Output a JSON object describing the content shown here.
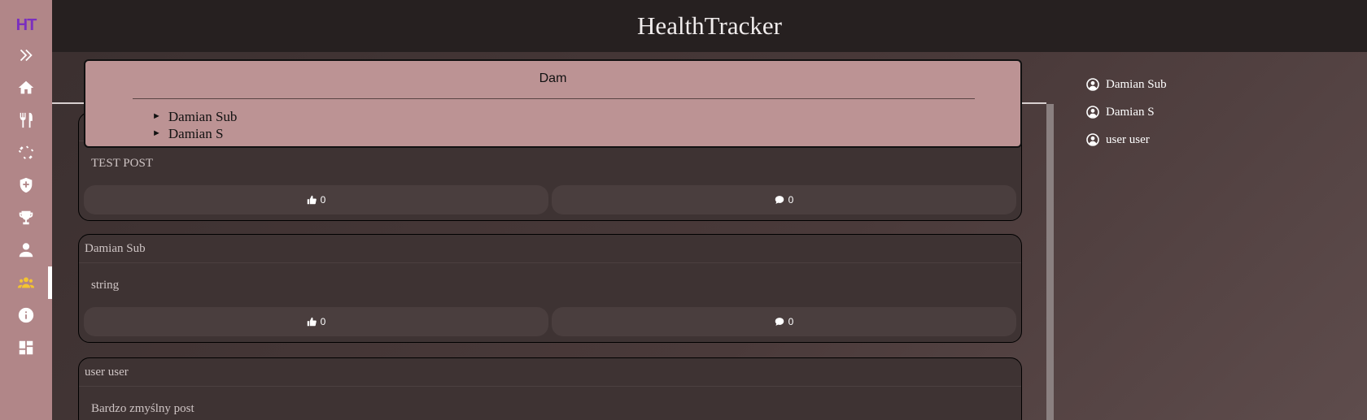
{
  "app": {
    "title": "HealthTracker",
    "logo": "HT"
  },
  "sidebar": {
    "items": [
      {
        "icon": "chevrons-right-icon"
      },
      {
        "icon": "home-icon"
      },
      {
        "icon": "utensils-icon"
      },
      {
        "icon": "dumbbell-icon"
      },
      {
        "icon": "shield-plus-icon"
      },
      {
        "icon": "trophy-icon"
      },
      {
        "icon": "user-icon"
      },
      {
        "icon": "users-icon",
        "active": true,
        "color": "#f4c430"
      },
      {
        "icon": "info-icon"
      },
      {
        "icon": "dashboard-icon"
      }
    ]
  },
  "search": {
    "query": "Dam",
    "results": [
      "Damian Sub",
      "Damian S"
    ]
  },
  "posts": [
    {
      "author": "",
      "body": "TEST POST",
      "likes": "0",
      "comments": "0"
    },
    {
      "author": "Damian Sub",
      "body": "string",
      "likes": "0",
      "comments": "0"
    },
    {
      "author": "user user",
      "body": "Bardzo zmyślny post"
    }
  ],
  "users": [
    "Damian Sub",
    "Damian S",
    "user user"
  ],
  "colors": {
    "sidebar": "#b18688",
    "header": "#262020",
    "popup": "#bc9394",
    "accent": "#f4c430",
    "logo": "#7b2fbf"
  }
}
